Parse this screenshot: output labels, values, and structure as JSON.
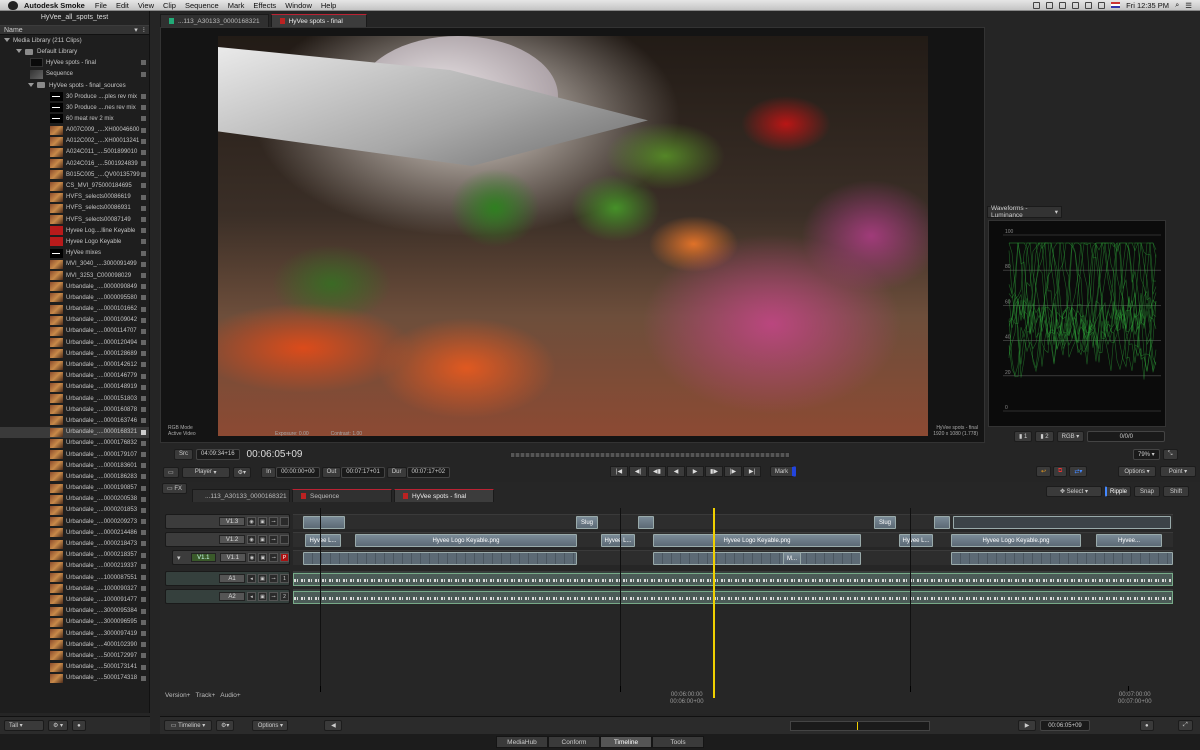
{
  "menubar": {
    "app": "Autodesk Smoke",
    "items": [
      "File",
      "Edit",
      "View",
      "Clip",
      "Sequence",
      "Mark",
      "Effects",
      "Window",
      "Help"
    ],
    "clock": "Fri 12:35 PM"
  },
  "library": {
    "project": "HyVee_all_spots_test",
    "column": "Name",
    "root": "Media Library (211 Clips)",
    "default": "Default Library",
    "items": [
      "HyVee spots - final",
      "Sequence"
    ],
    "folder": "HyVee spots - final_sources",
    "clips": [
      "30 Produce ....ples rev mix",
      "30 Produce ....nes rev mix",
      "60 meat rev 2 mix",
      "A007C009_....XH00046600",
      "A012C002_....XH00013241",
      "A024C011_....5001899010",
      "A024C016_....5001924839",
      "B015C005_....QV00135799",
      "CS_MVI_975000184695",
      "HVFS_selects00086619",
      "HVFS_selects00086931",
      "HVFS_selects00087149",
      "Hyvee Log....lline Keyable",
      "Hyvee Logo Keyable",
      "HyVee mixes",
      "MVI_3040_....3000091499",
      "MVI_3253_C000098029",
      "Urbandale_....0000090849",
      "Urbandale_....0000095580",
      "Urbandale_....0000101662",
      "Urbandale_....0000109042",
      "Urbandale_....0000114707",
      "Urbandale_....0000120494",
      "Urbandale_....0000128689",
      "Urbandale_....0000142612",
      "Urbandale_....0000146779",
      "Urbandale_....0000148919",
      "Urbandale_....0000151803",
      "Urbandale_....0000160878",
      "Urbandale_....0000163746",
      "Urbandale_....0000168321",
      "Urbandale_....0000176832",
      "Urbandale_....0000179107",
      "Urbandale_....0000183601",
      "Urbandale_....0000186283",
      "Urbandale_....0000190857",
      "Urbandale_....0000200538",
      "Urbandale_....0000201853",
      "Urbandale_....0000209273",
      "Urbandale_....0000214486",
      "Urbandale_....0000218473",
      "Urbandale_....0000218357",
      "Urbandale_....0000219337",
      "Urbandale_....1000087551",
      "Urbandale_....1000090327",
      "Urbandale_....1000091477",
      "Urbandale_....3000095384",
      "Urbandale_....3000096595",
      "Urbandale_....3000097419",
      "Urbandale_....4000102390",
      "Urbandale_....5000172997",
      "Urbandale_....5000173141",
      "Urbandale_....5000174318"
    ],
    "selected_index": 30,
    "footer": {
      "view": "Tall"
    }
  },
  "viewer": {
    "tabs": [
      "...113_A30133_0000168321",
      "HyVee spots - final"
    ],
    "overlay_left": [
      "RGB Mode",
      "Active   Video"
    ],
    "overlay_mid": [
      "Exposure: 0.00",
      "Contrast: 1.00"
    ],
    "overlay_right": [
      "HyVee spots - final",
      "1920 x 1080 (1.778)"
    ],
    "src_label": "Src",
    "src_tc": "04:09:34+16",
    "big_tc": "00:06:05+09",
    "zoom": "79%"
  },
  "waveform": {
    "mode": "Waveforms - Luminance",
    "scale": [
      "100",
      "80",
      "60",
      "40",
      "20",
      "0"
    ],
    "buttons": [
      "1",
      "2",
      "RGB"
    ],
    "value": "0/0/0"
  },
  "player": {
    "label": "Player",
    "in_label": "In",
    "in_tc": "00:00:00+00",
    "out_label": "Out",
    "out_tc": "00:07:17+01",
    "dur_label": "Dur",
    "dur_tc": "00:07:17+02",
    "mark": "Mark",
    "options": "Options",
    "mode": "Point"
  },
  "timeline": {
    "fx": "FX",
    "tabs": [
      "...113_A30133_0000168321",
      "Sequence",
      "HyVee spots - final"
    ],
    "tools": [
      "Select",
      "Ripple",
      "Snap",
      "Shift"
    ],
    "tracks": [
      {
        "id": "V1.3"
      },
      {
        "id": "V1.2"
      },
      {
        "id": "V1.1",
        "src": "V1.1"
      },
      {
        "id": "A1",
        "ch": "1"
      },
      {
        "id": "A2",
        "ch": "2"
      }
    ],
    "clips": {
      "slug": "Slug",
      "logo": "Hyvee Logo Keyable.png",
      "logo_short": "Hyvee L...",
      "logo_short2": "Hyvee L...",
      "hyvee_dots": "Hyvee...",
      "mini": "M..."
    },
    "foot": [
      "Version+",
      "Track+",
      "Audio+"
    ],
    "tc_mid": [
      "00:06:00:00",
      "00:06:00+00"
    ],
    "tc_right": [
      "00:07:00:00",
      "00:07:00+00"
    ]
  },
  "bottom": {
    "view": "Timeline",
    "options": "Options",
    "tc": "00:06:05+09"
  },
  "apptabs": [
    "MediaHub",
    "Conform",
    "Timeline",
    "Tools"
  ],
  "apptabs_active": "Timeline"
}
